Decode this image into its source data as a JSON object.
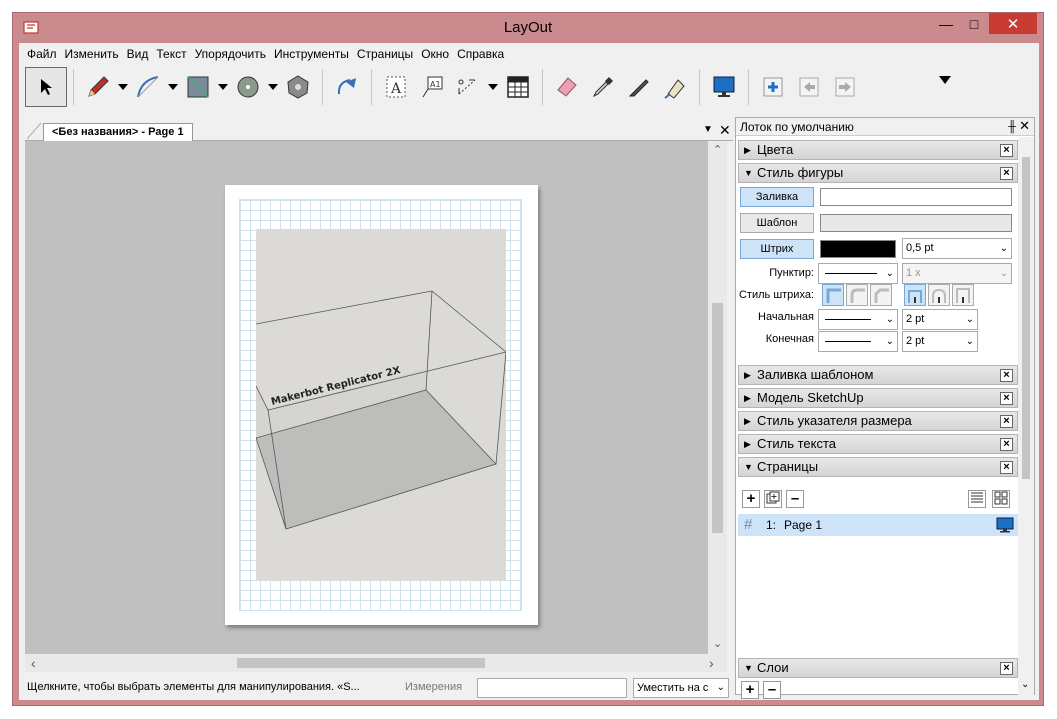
{
  "window": {
    "title": "LayOut"
  },
  "menu": [
    "Файл",
    "Изменить",
    "Вид",
    "Текст",
    "Упорядочить",
    "Инструменты",
    "Страницы",
    "Окно",
    "Справка"
  ],
  "document": {
    "tab_label": "<Без названия> - Page 1",
    "model_label": "Makerbot Replicator 2X"
  },
  "status": {
    "message": "Щелкните, чтобы выбрать элементы для манипулирования. «S...",
    "measure_label": "Измерения",
    "measure_value": "",
    "zoom": "Уместить на с"
  },
  "tray": {
    "title": "Лоток по умолчанию",
    "sections": {
      "colors": "Цвета",
      "shape_style": "Стиль фигуры",
      "pattern_fill": "Заливка шаблоном",
      "sketchup_model": "Модель SketchUp",
      "dimension_style": "Стиль указателя размера",
      "text_style": "Стиль текста",
      "pages": "Страницы",
      "layers": "Слои"
    },
    "shape_style": {
      "fill_label": "Заливка",
      "pattern_label": "Шаблон",
      "stroke_label": "Штрих",
      "stroke_color": "#000000",
      "stroke_width": "0,5 pt",
      "dash_label": "Пунктир:",
      "dash_scale": "1 x",
      "stroke_style_label": "Стиль штриха:",
      "start_label": "Начальная",
      "start_size": "2 pt",
      "end_label": "Конечная",
      "end_size": "2 pt"
    },
    "pages": {
      "items": [
        {
          "number": "1:",
          "name": "Page 1"
        }
      ]
    }
  }
}
